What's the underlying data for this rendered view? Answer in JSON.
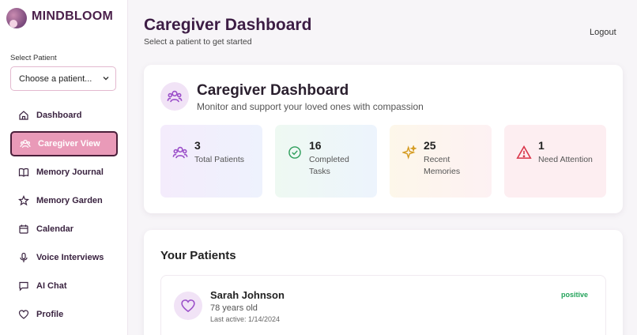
{
  "brand": {
    "name": "MINDBLOOM"
  },
  "sidebar": {
    "select_label": "Select Patient",
    "select_value": "Choose a patient...",
    "items": [
      {
        "label": "Dashboard",
        "icon": "home-icon"
      },
      {
        "label": "Caregiver View",
        "icon": "users-icon",
        "active": true
      },
      {
        "label": "Memory Journal",
        "icon": "book-icon"
      },
      {
        "label": "Memory Garden",
        "icon": "star-icon"
      },
      {
        "label": "Calendar",
        "icon": "calendar-icon"
      },
      {
        "label": "Voice Interviews",
        "icon": "mic-icon"
      },
      {
        "label": "AI Chat",
        "icon": "chat-icon"
      },
      {
        "label": "Profile",
        "icon": "heart-icon"
      }
    ]
  },
  "header": {
    "title": "Caregiver Dashboard",
    "subtitle": "Select a patient to get started",
    "logout": "Logout"
  },
  "overview": {
    "title": "Caregiver Dashboard",
    "subtitle": "Monitor and support your loved ones with compassion",
    "stats": [
      {
        "value": "3",
        "label": "Total Patients",
        "icon": "users-icon",
        "color": "#9b4fc9"
      },
      {
        "value": "16",
        "label": "Completed Tasks",
        "icon": "check-circle-icon",
        "color": "#2e9e5b"
      },
      {
        "value": "25",
        "label": "Recent Memories",
        "icon": "sparkles-icon",
        "color": "#d49a1e"
      },
      {
        "value": "1",
        "label": "Need Attention",
        "icon": "warning-icon",
        "color": "#d9364a"
      }
    ]
  },
  "patients": {
    "title": "Your Patients",
    "list": [
      {
        "name": "Sarah Johnson",
        "age": "78 years old",
        "last_active": "Last active: 1/14/2024",
        "mood": "positive"
      }
    ]
  },
  "colors": {
    "accent": "#e99ab8",
    "brand": "#4a1f4a",
    "positive": "#22a35a"
  }
}
